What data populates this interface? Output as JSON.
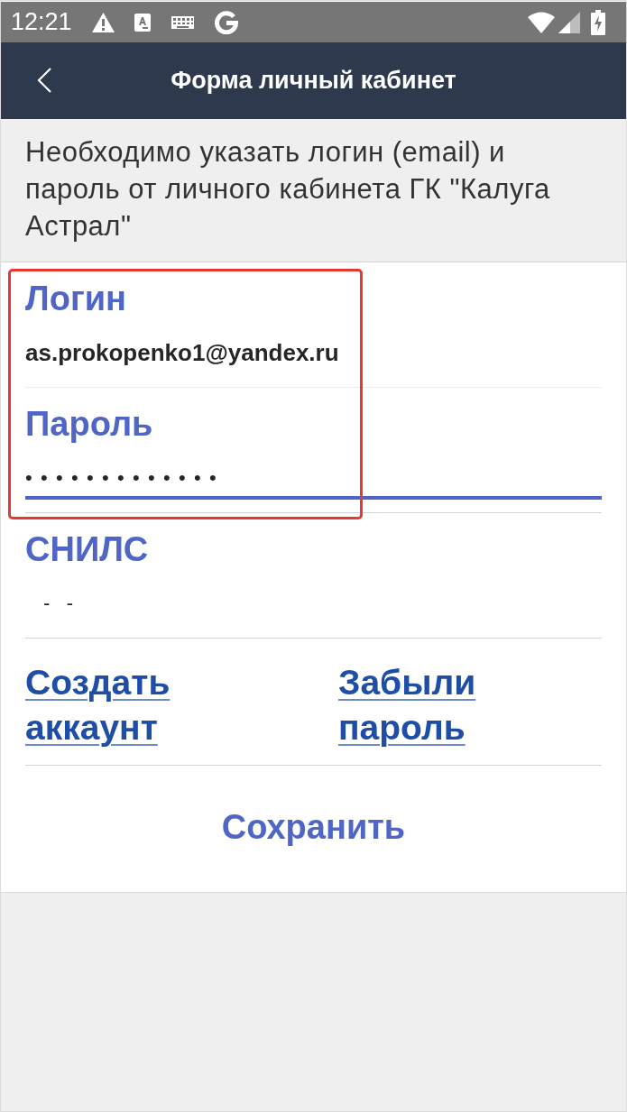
{
  "status_bar": {
    "time": "12:21"
  },
  "app_bar": {
    "title": "Форма личный кабинет"
  },
  "notice": "Необходимо указать логин (email) и пароль от личного кабинета ГК \"Калуга Астрал\"",
  "sections": [
    {
      "highlighted": true,
      "fields": [
        {
          "kind": "text",
          "label": "Логин",
          "value": "as.prokopenko1@yandex.ru",
          "focused": false
        },
        {
          "kind": "password",
          "label": "Пароль",
          "value": "•••••••••••••",
          "focused": true
        }
      ]
    },
    {
      "highlighted": false,
      "fields": [
        {
          "kind": "masked",
          "label": "СНИЛС",
          "value": "-   -",
          "focused": false
        }
      ]
    }
  ],
  "links": [
    "Создать аккаунт",
    "Забыли пароль"
  ],
  "save_button": "Сохранить"
}
